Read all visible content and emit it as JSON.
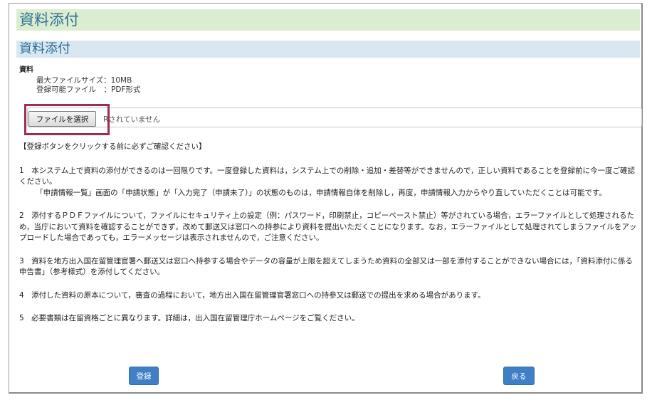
{
  "page": {
    "title": "資料添付"
  },
  "section": {
    "title": "資料添付",
    "field_label": "資料",
    "max_file_size": "最大ファイルサイズ：10MB",
    "allowed_file_type": "登録可能ファイル　：PDF形式"
  },
  "file_input": {
    "button_label": "ファイルを選択",
    "status_text": "Rされていません"
  },
  "notice": {
    "heading": "【登録ボタンをクリックする前に必ずご確認ください】",
    "item1": "1　本システム上で資料の添付ができるのは一回限りです。一度登録した資料は，システム上での削除・追加・差替等ができませんので，正しい資料であることを登録前に今一度ご確認ください。",
    "item1_note": "「申請情報一覧」画面の「申請状態」が「入力完了（申請未了）」の状態のものは，申請情報自体を削除し，再度，申請情報入力からやり直していただくことは可能です。",
    "item2": "2　添付するＰＤＦファイルについて，ファイルにセキュリティ上の設定（例：パスワード，印刷禁止，コピーペースト禁止）等がされている場合，エラーファイルとして処理されるため，当庁において資料を確認することができず，改めて郵送又は窓口への持参により資料を提出いただくことになります。なお，エラーファイルとして処理されてしまうファイルをアップロードした場合であっても，エラーメッセージは表示されませんので，ご注意ください。",
    "item3": "3　資料を地方出入国在留管理官署へ郵送又は窓口へ持参する場合やデータの容量が上限を超えてしまうため資料の全部又は一部を添付することができない場合には，「資料添付に係る申告書」（参考様式）を添付してください。",
    "item4": "4　添付した資料の原本について，審査の過程において，地方出入国在留管理官署窓口への持参又は郵送での提出を求める場合があります。",
    "item5": "5　必要書類は在留資格ごとに異なります。詳細は，出入国在留管理庁ホームページをご覧ください。"
  },
  "actions": {
    "register_label": "登録",
    "back_label": "戻る"
  },
  "colors": {
    "page_header_bg": "#dbedd0",
    "section_header_bg": "#d8e7f2",
    "title_text": "#2e6f95",
    "highlight_border": "#9c2f4d",
    "primary_button": "#3f7fc6"
  }
}
